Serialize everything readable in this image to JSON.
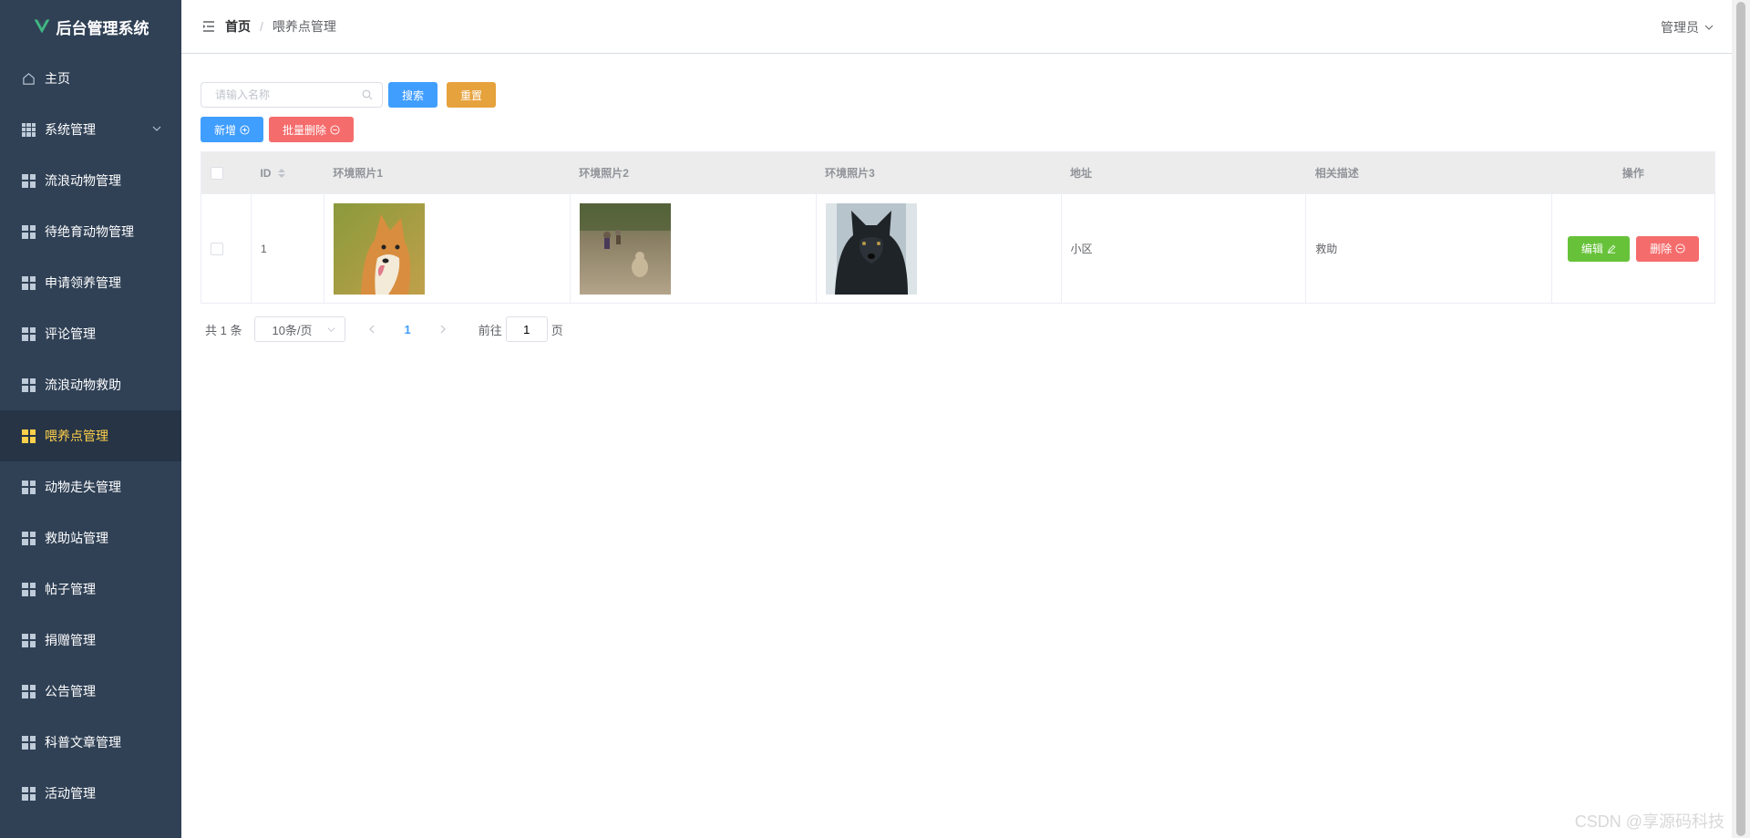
{
  "app": {
    "title": "后台管理系统"
  },
  "sidebar": {
    "items": [
      {
        "label": "主页",
        "icon": "home-icon"
      },
      {
        "label": "系统管理",
        "icon": "grid-icon",
        "expandable": true
      },
      {
        "label": "流浪动物管理",
        "icon": "grid-icon"
      },
      {
        "label": "待绝育动物管理",
        "icon": "grid-icon"
      },
      {
        "label": "申请领养管理",
        "icon": "grid-icon"
      },
      {
        "label": "评论管理",
        "icon": "grid-icon"
      },
      {
        "label": "流浪动物救助",
        "icon": "grid-icon"
      },
      {
        "label": "喂养点管理",
        "icon": "grid-icon",
        "active": true
      },
      {
        "label": "动物走失管理",
        "icon": "grid-icon"
      },
      {
        "label": "救助站管理",
        "icon": "grid-icon"
      },
      {
        "label": "帖子管理",
        "icon": "grid-icon"
      },
      {
        "label": "捐赠管理",
        "icon": "grid-icon"
      },
      {
        "label": "公告管理",
        "icon": "grid-icon"
      },
      {
        "label": "科普文章管理",
        "icon": "grid-icon"
      },
      {
        "label": "活动管理",
        "icon": "grid-icon"
      }
    ]
  },
  "header": {
    "breadcrumb_home": "首页",
    "breadcrumb_sep": "/",
    "breadcrumb_current": "喂养点管理",
    "user": "管理员"
  },
  "toolbar": {
    "search_placeholder": "请输入名称",
    "search_label": "搜索",
    "reset_label": "重置",
    "add_label": "新增",
    "batch_delete_label": "批量删除"
  },
  "table": {
    "columns": [
      "ID",
      "环境照片1",
      "环境照片2",
      "环境照片3",
      "地址",
      "相关描述",
      "操作"
    ],
    "rows": [
      {
        "id": "1",
        "photos": [
          "akita-dog-photo",
          "street-dogs-photo",
          "black-dog-photo"
        ],
        "address": "小区",
        "description": "救助",
        "edit_label": "编辑",
        "delete_label": "删除"
      }
    ]
  },
  "pagination": {
    "total": "共 1 条",
    "page_size": "10条/页",
    "current_page": "1",
    "goto_prefix": "前往",
    "goto_value": "1",
    "goto_suffix": "页"
  },
  "watermark": "CSDN @享源码科技",
  "colors": {
    "sidebar_bg": "#304156",
    "active": "#ffd04b",
    "primary": "#409eff",
    "warning": "#e6a23c",
    "danger": "#f56c6c",
    "success": "#67c23a"
  }
}
